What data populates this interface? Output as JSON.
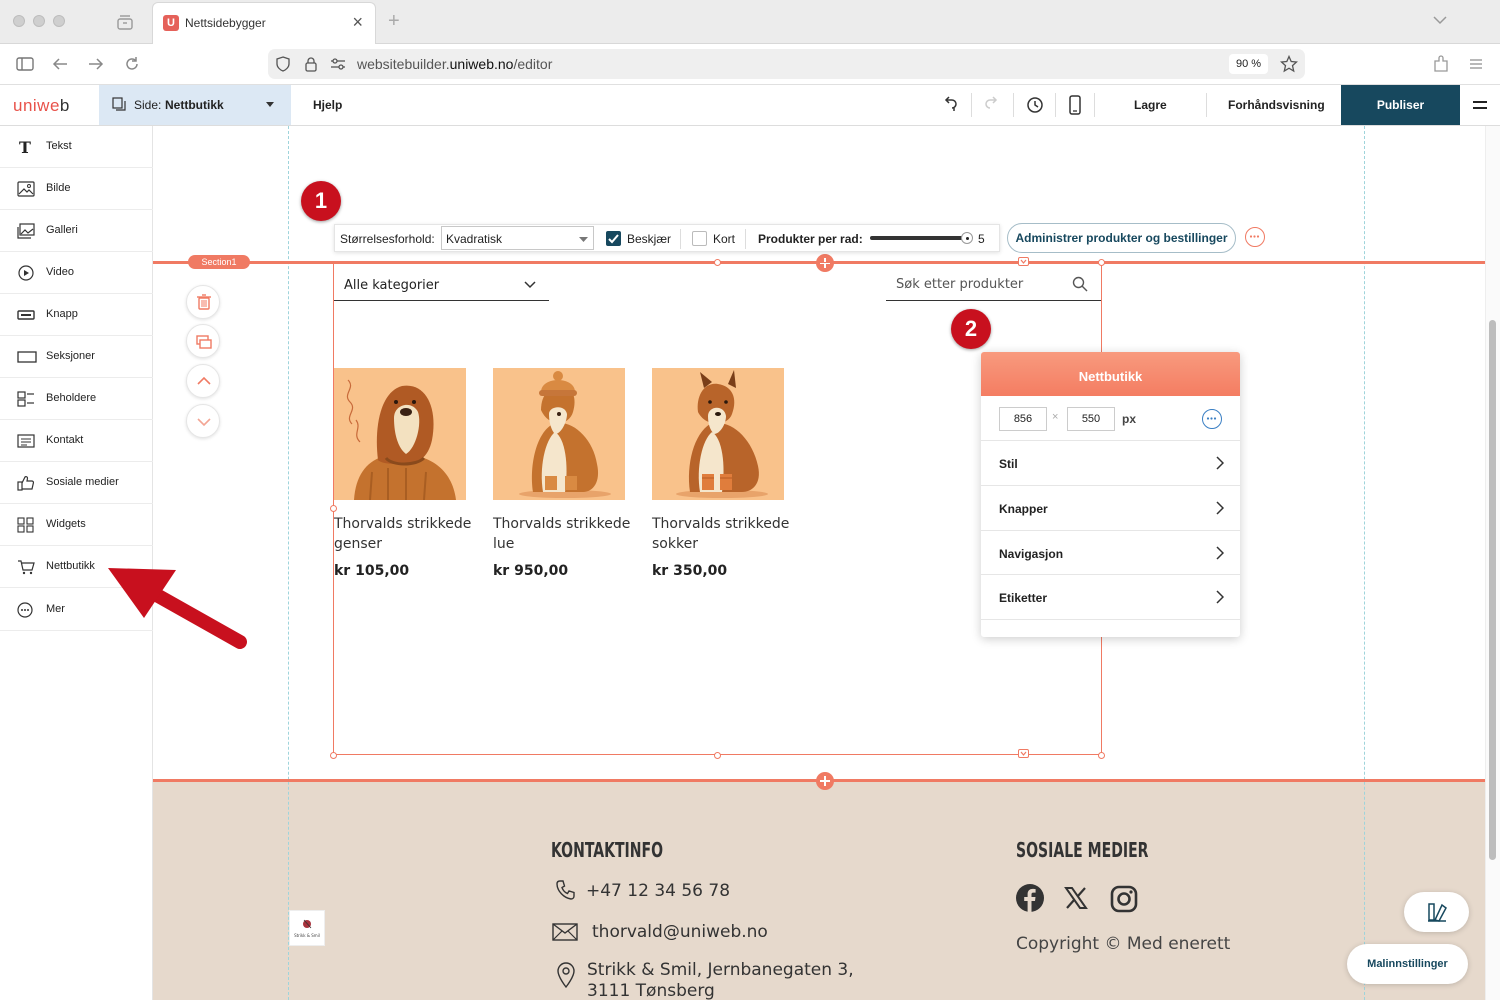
{
  "browser": {
    "tab_title": "Nettsidebygger",
    "tab_favicon": "U",
    "url_prefix": "websitebuilder.",
    "url_domain": "uniweb.no",
    "url_path": "/editor",
    "zoom": "90 %"
  },
  "editor": {
    "logo_a": "uniwe",
    "logo_b": "b",
    "page_prefix": "Side:",
    "page_name": "Nettbutikk",
    "help": "Hjelp",
    "save": "Lagre",
    "preview": "Forhåndsvisning",
    "publish": "Publiser"
  },
  "sidebar": {
    "items": [
      {
        "label": "Tekst",
        "icon": "text-icon"
      },
      {
        "label": "Bilde",
        "icon": "image-icon"
      },
      {
        "label": "Galleri",
        "icon": "gallery-icon"
      },
      {
        "label": "Video",
        "icon": "video-icon"
      },
      {
        "label": "Knapp",
        "icon": "button-icon"
      },
      {
        "label": "Seksjoner",
        "icon": "sections-icon"
      },
      {
        "label": "Beholdere",
        "icon": "containers-icon"
      },
      {
        "label": "Kontakt",
        "icon": "contact-icon"
      },
      {
        "label": "Sosiale medier",
        "icon": "thumbs-up-icon"
      },
      {
        "label": "Widgets",
        "icon": "widgets-icon"
      },
      {
        "label": "Nettbutikk",
        "icon": "cart-icon"
      },
      {
        "label": "Mer",
        "icon": "more-icon"
      }
    ]
  },
  "section": {
    "tag": "Section1"
  },
  "widget_toolbar": {
    "ratio_label": "Størrelsesforhold:",
    "ratio_value": "Kvadratisk",
    "crop_label": "Beskjær",
    "crop_checked": true,
    "card_label": "Kort",
    "card_checked": false,
    "per_row_label": "Produkter per rad:",
    "per_row_value": "5",
    "per_row_fraction": 0.97,
    "admin_button": "Administrer produkter og bestillinger"
  },
  "store": {
    "category": "Alle kategorier",
    "search_placeholder": "Søk etter produkter",
    "products": [
      {
        "name": "Thorvalds strikkede genser",
        "price": "kr 105,00"
      },
      {
        "name": "Thorvalds strikkede lue",
        "price": "kr 950,00"
      },
      {
        "name": "Thorvalds strikkede sokker",
        "price": "kr 350,00"
      }
    ]
  },
  "badges": [
    "1",
    "2"
  ],
  "panel": {
    "title": "Nettbutikk",
    "width": "856",
    "height": "550",
    "unit": "px",
    "rows": [
      "Stil",
      "Knapper",
      "Navigasjon",
      "Etiketter"
    ]
  },
  "footer": {
    "contact_heading": "KONTAKTINFO",
    "phone": "+47 12 34 56 78",
    "email": "thorvald@uniweb.no",
    "address_line1": "Strikk & Smil, Jernbanegaten 3,",
    "address_line2": "3111 Tønsberg",
    "social_heading": "SOSIALE MEDIER",
    "copyright": "Copyright © Med enerett",
    "logo_text": "Strikk & Smil"
  },
  "template_settings": "Malinnstillinger",
  "colors": {
    "accent": "#f07a63",
    "publish": "#17485e",
    "arrow": "#c8101e",
    "footer_bg": "#e6d9cc"
  }
}
